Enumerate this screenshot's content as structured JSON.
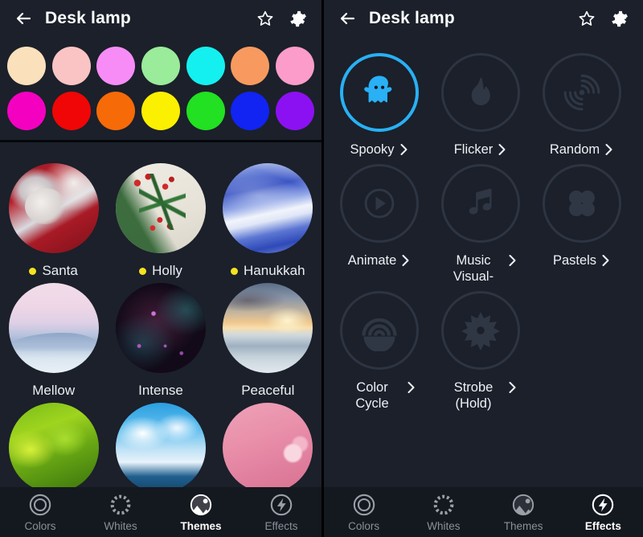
{
  "header": {
    "back_icon": "back-arrow-icon",
    "title": "Desk lamp",
    "favorite_icon": "star-outline-icon",
    "settings_icon": "gear-icon"
  },
  "left_panel": {
    "active_tab": "Themes",
    "color_swatches": {
      "row1": [
        {
          "name": "cream",
          "hex": "#fbe0bc"
        },
        {
          "name": "light-pink",
          "hex": "#fac4c4"
        },
        {
          "name": "orchid",
          "hex": "#f78cf7"
        },
        {
          "name": "light-green",
          "hex": "#9aeb9a"
        },
        {
          "name": "cyan",
          "hex": "#14f0ef"
        },
        {
          "name": "coral",
          "hex": "#f89a5f"
        },
        {
          "name": "pink",
          "hex": "#fc9ccb"
        }
      ],
      "row2": [
        {
          "name": "magenta",
          "hex": "#f400c0"
        },
        {
          "name": "red",
          "hex": "#f00606"
        },
        {
          "name": "orange",
          "hex": "#f76a08"
        },
        {
          "name": "yellow",
          "hex": "#fbf000"
        },
        {
          "name": "green",
          "hex": "#22e022"
        },
        {
          "name": "blue",
          "hex": "#1124f2"
        },
        {
          "name": "violet",
          "hex": "#8c11f2"
        }
      ]
    },
    "themes": [
      [
        {
          "label": "Santa",
          "art": "art-santa",
          "dot": true,
          "dot_color": "#f5e221"
        },
        {
          "label": "Holly",
          "art": "art-holly",
          "dot": true,
          "dot_color": "#f5e221"
        },
        {
          "label": "Hanukkah",
          "art": "art-hanukkah",
          "dot": true,
          "dot_color": "#f5e221"
        }
      ],
      [
        {
          "label": "Mellow",
          "art": "art-mellow",
          "dot": false,
          "dot_color": ""
        },
        {
          "label": "Intense",
          "art": "art-intense",
          "dot": false,
          "dot_color": ""
        },
        {
          "label": "Peaceful",
          "art": "art-peaceful",
          "dot": false,
          "dot_color": ""
        }
      ],
      [
        {
          "label": "",
          "art": "art-leaves",
          "dot": false,
          "dot_color": ""
        },
        {
          "label": "",
          "art": "art-sky",
          "dot": false,
          "dot_color": ""
        },
        {
          "label": "",
          "art": "art-blossom",
          "dot": false,
          "dot_color": ""
        }
      ]
    ],
    "bottom_nav": [
      {
        "label": "Colors",
        "icon": "colors-ring-icon",
        "active": false
      },
      {
        "label": "Whites",
        "icon": "whites-dashed-icon",
        "active": false
      },
      {
        "label": "Themes",
        "icon": "themes-image-icon",
        "active": true
      },
      {
        "label": "Effects",
        "icon": "effects-bolt-icon",
        "active": false
      }
    ]
  },
  "right_panel": {
    "active_tab": "Effects",
    "selected_effect": "Spooky",
    "selection_color": "#29b0f5",
    "effects": [
      [
        {
          "label": "Spooky",
          "icon": "ghost-icon",
          "selected": true,
          "chevron": true
        },
        {
          "label": "Flicker",
          "icon": "flame-icon",
          "selected": false,
          "chevron": true
        },
        {
          "label": "Random",
          "icon": "radar-swirl-icon",
          "selected": false,
          "chevron": true
        }
      ],
      [
        {
          "label": "Animate",
          "icon": "play-circle-icon",
          "selected": false,
          "chevron": true
        },
        {
          "label": "Music Visual-",
          "icon": "music-note-icon",
          "selected": false,
          "chevron": true
        },
        {
          "label": "Pastels",
          "icon": "four-circles-icon",
          "selected": false,
          "chevron": true
        }
      ],
      [
        {
          "label": "Color Cycle",
          "icon": "rainbow-arcs-icon",
          "selected": false,
          "chevron": true
        },
        {
          "label": "Strobe (Hold)",
          "icon": "starburst-icon",
          "selected": false,
          "chevron": true
        }
      ]
    ],
    "bottom_nav": [
      {
        "label": "Colors",
        "icon": "colors-ring-icon",
        "active": false
      },
      {
        "label": "Whites",
        "icon": "whites-dashed-icon",
        "active": false
      },
      {
        "label": "Themes",
        "icon": "themes-image-icon",
        "active": false
      },
      {
        "label": "Effects",
        "icon": "effects-bolt-icon",
        "active": true
      }
    ]
  }
}
